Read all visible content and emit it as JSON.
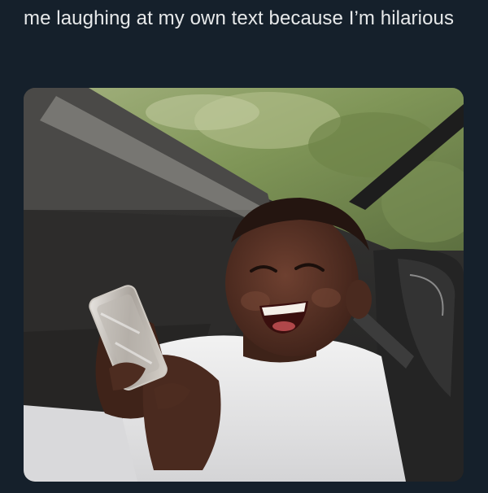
{
  "post": {
    "caption": "me laughing at my own text because I’m hilarious"
  },
  "media": {
    "alt_kind": "photo",
    "subject_icon": "child-laughing-with-phone-photo"
  },
  "colors": {
    "background": "#15202b",
    "caption_text": "#e7e9ea"
  }
}
